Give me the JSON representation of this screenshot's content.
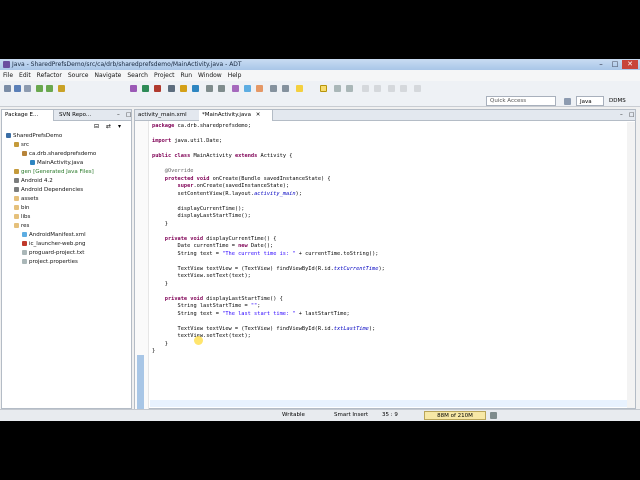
{
  "window": {
    "title": "Java - SharedPrefsDemo/src/ca/drb/sharedprefsdemo/MainActivity.java - ADT"
  },
  "menu": [
    "File",
    "Edit",
    "Refactor",
    "Source",
    "Navigate",
    "Search",
    "Project",
    "Run",
    "Window",
    "Help"
  ],
  "toolbar": {
    "quick_access": "Quick Access",
    "perspective_java": "Java",
    "perspective_ddms": "DDMS"
  },
  "package_explorer": {
    "tabs": [
      "Package E...",
      "SVN Repo..."
    ],
    "tree": [
      {
        "label": "SharedPrefsDemo",
        "indent": 1
      },
      {
        "label": "src",
        "indent": 2
      },
      {
        "label": "ca.drb.sharedprefsdemo",
        "indent": 3
      },
      {
        "label": "MainActivity.java",
        "indent": 4
      },
      {
        "label": "gen [Generated Java Files]",
        "indent": 2
      },
      {
        "label": "Android 4.2",
        "indent": 2
      },
      {
        "label": "Android Dependencies",
        "indent": 2
      },
      {
        "label": "assets",
        "indent": 2
      },
      {
        "label": "bin",
        "indent": 2
      },
      {
        "label": "libs",
        "indent": 2
      },
      {
        "label": "res",
        "indent": 2
      },
      {
        "label": "AndroidManifest.xml",
        "indent": 2
      },
      {
        "label": "ic_launcher-web.png",
        "indent": 2
      },
      {
        "label": "proguard-project.txt",
        "indent": 2
      },
      {
        "label": "project.properties",
        "indent": 2
      }
    ]
  },
  "editor": {
    "tabs": [
      "activity_main.xml",
      "*MainActivity.java"
    ],
    "lines": [
      "package ca.drb.sharedprefsdemo;",
      "",
      "import java.util.Date;",
      "",
      "public class MainActivity extends Activity {",
      "",
      "    @Override",
      "    protected void onCreate(Bundle savedInstanceState) {",
      "        super.onCreate(savedInstanceState);",
      "        setContentView(R.layout.activity_main);",
      "",
      "        displayCurrentTime();",
      "        displayLastStartTime();",
      "    }",
      "",
      "    private void displayCurrentTime() {",
      "        Date currentTime = new Date();",
      "        String text = \"The current time is: \" + currentTime.toString();",
      "",
      "        TextView textView = (TextView) findViewById(R.id.txtCurrentTime);",
      "        textView.setText(text);",
      "    }",
      "",
      "    private void displayLastStartTime() {",
      "        String lastStartTime = \"\";",
      "        String text = \"The last start time: \" + lastStartTime;",
      "",
      "        TextView textView = (TextView) findViewById(R.id.txtLastTime);",
      "        textView.setText(text);",
      "    }",
      "}"
    ]
  },
  "status": {
    "mode": "Writable",
    "insert": "Smart Insert",
    "position": "35 : 9",
    "heap": "88M of 210M"
  },
  "colors": {
    "keyword": "#7f0055",
    "string": "#2a00ff",
    "field": "#0000c0"
  }
}
